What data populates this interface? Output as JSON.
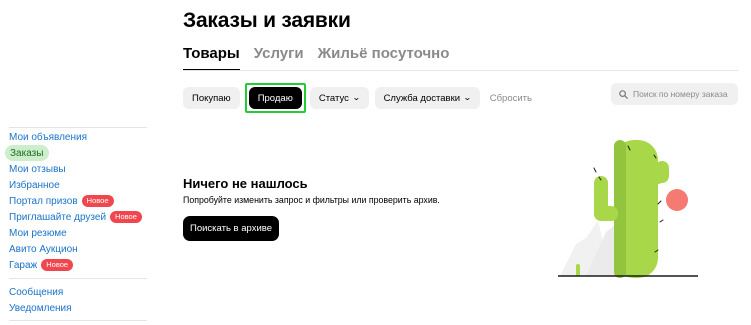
{
  "page": {
    "title": "Заказы и заявки"
  },
  "tabs": [
    {
      "label": "Товары",
      "active": true
    },
    {
      "label": "Услуги",
      "active": false
    },
    {
      "label": "Жильё посуточно",
      "active": false
    }
  ],
  "filters": {
    "buy_label": "Покупаю",
    "sell_label": "Продаю",
    "status_label": "Статус",
    "delivery_label": "Служба доставки",
    "reset_label": "Сбросить",
    "selected": "Продаю"
  },
  "search": {
    "placeholder": "Поиск по номеру заказа"
  },
  "sidebar": {
    "items": [
      {
        "label": "Мои объявления"
      },
      {
        "label": "Заказы",
        "active": true
      },
      {
        "label": "Мои отзывы"
      },
      {
        "label": "Избранное"
      },
      {
        "label": "Портал призов",
        "badge": "Новое"
      },
      {
        "label": "Приглашайте друзей",
        "badge": "Новое"
      },
      {
        "label": "Мои резюме"
      },
      {
        "label": "Авито Аукцион"
      },
      {
        "label": "Гараж",
        "badge": "Новое"
      }
    ],
    "items2": [
      {
        "label": "Сообщения"
      },
      {
        "label": "Уведомления"
      }
    ]
  },
  "empty_state": {
    "title": "Ничего не нашлось",
    "text": "Попробуйте изменить запрос и фильтры или проверить архив.",
    "button_label": "Поискать в архиве"
  },
  "icons": {
    "search": "search-icon",
    "chevron": "chevron-down-icon",
    "illustration": "cactus-illustration"
  },
  "colors": {
    "link": "#1a73c8",
    "active_bg": "#cdeecb",
    "badge": "#f0474e",
    "highlight": "#22cc33",
    "cactus": "#a8d84a",
    "sun": "#f47a72"
  }
}
